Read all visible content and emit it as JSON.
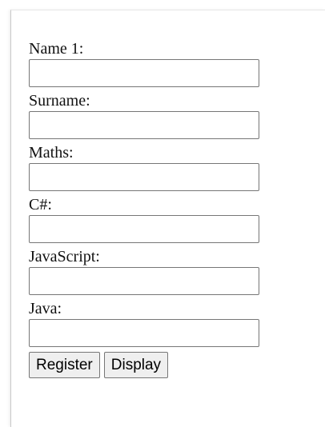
{
  "form": {
    "fields": [
      {
        "label": "Name 1:",
        "value": ""
      },
      {
        "label": "Surname:",
        "value": ""
      },
      {
        "label": "Maths:",
        "value": ""
      },
      {
        "label": "C#:",
        "value": ""
      },
      {
        "label": "JavaScript:",
        "value": ""
      },
      {
        "label": "Java:",
        "value": ""
      }
    ],
    "register_label": "Register",
    "display_label": "Display"
  }
}
